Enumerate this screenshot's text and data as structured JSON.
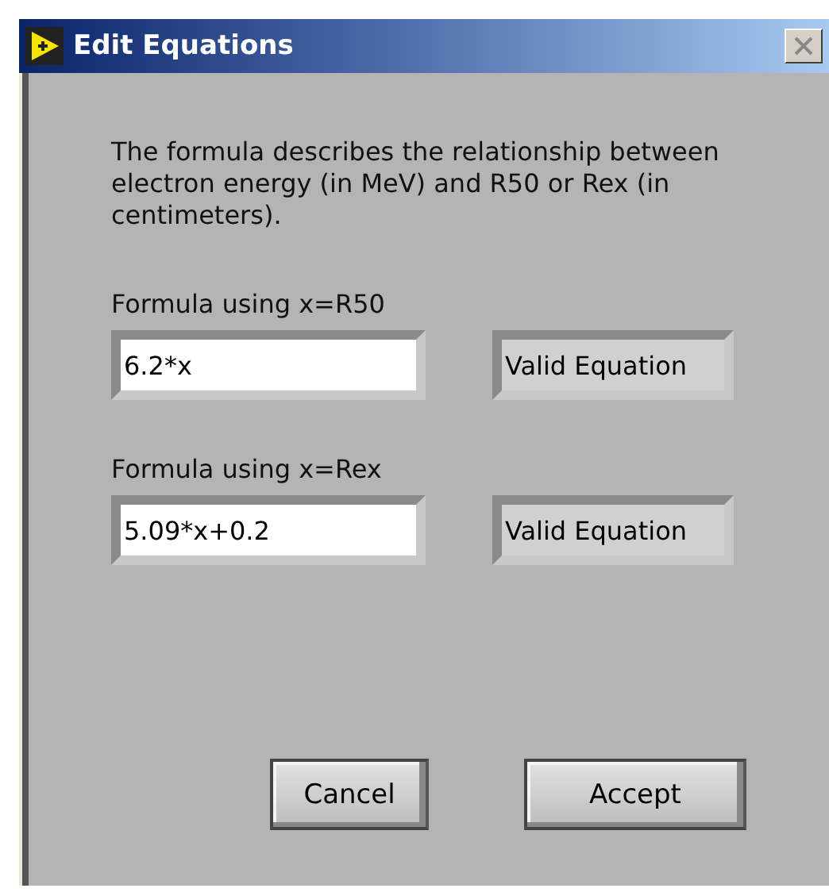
{
  "window": {
    "title": "Edit Equations"
  },
  "description": "The formula describes the relationship between electron energy (in MeV) and R50 or Rex (in centimeters).",
  "formulas": [
    {
      "label": "Formula using x=R50",
      "value": "6.2*x",
      "status": "Valid Equation"
    },
    {
      "label": "Formula using x=Rex",
      "value": "5.09*x+0.2",
      "status": "Valid Equation"
    }
  ],
  "buttons": [
    {
      "label": "Cancel",
      "kind": "secondary"
    },
    {
      "label": "Accept",
      "kind": "primary"
    }
  ]
}
